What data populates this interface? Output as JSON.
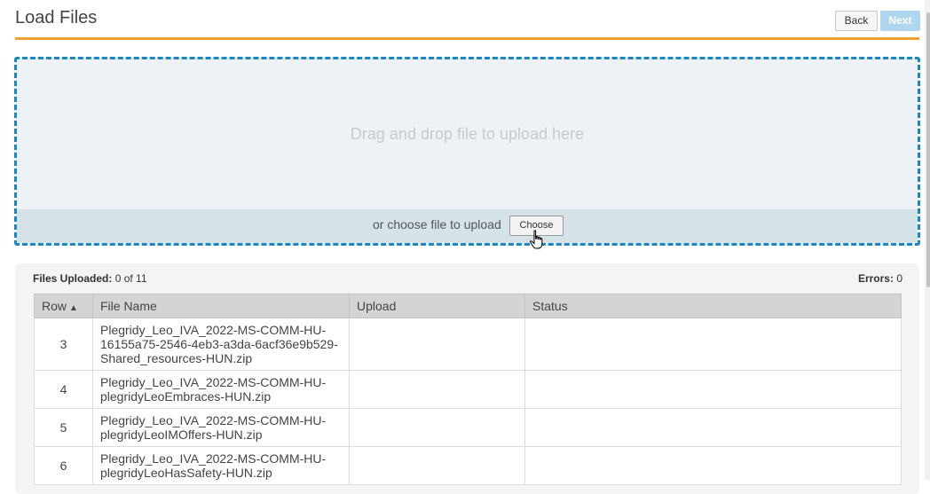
{
  "header": {
    "title": "Load Files",
    "back_label": "Back",
    "next_label": "Next"
  },
  "dropzone": {
    "drop_text": "Drag and drop file to upload here",
    "choose_text": "or choose file to upload",
    "choose_label": "Choose"
  },
  "summary": {
    "files_uploaded_label": "Files Uploaded:",
    "files_uploaded_value": "0 of 11",
    "errors_label": "Errors:",
    "errors_value": "0"
  },
  "table": {
    "columns": [
      "Row",
      "File Name",
      "Upload",
      "Status"
    ],
    "sort_indicator": "▲",
    "rows": [
      {
        "row": "3",
        "file_lines": [
          "Plegridy_Leo_IVA_2022-MS-COMM-HU-",
          "16155a75-2546-4eb3-a3da-6acf36e9b529-",
          "Shared_resources-HUN.zip"
        ],
        "upload": "",
        "status": ""
      },
      {
        "row": "4",
        "file_lines": [
          "Plegridy_Leo_IVA_2022-MS-COMM-HU-",
          "plegridyLeoEmbraces-HUN.zip"
        ],
        "upload": "",
        "status": ""
      },
      {
        "row": "5",
        "file_lines": [
          "Plegridy_Leo_IVA_2022-MS-COMM-HU-",
          "plegridyLeoIMOffers-HUN.zip"
        ],
        "upload": "",
        "status": ""
      },
      {
        "row": "6",
        "file_lines": [
          "Plegridy_Leo_IVA_2022-MS-COMM-HU-",
          "plegridyLeoHasSafety-HUN.zip"
        ],
        "upload": "",
        "status": ""
      }
    ]
  },
  "colors": {
    "accent_orange": "#f0a030",
    "dropzone_border": "#1a86c2",
    "next_button": "#aed6ee"
  },
  "icons": {
    "sort": "triangle-up-icon",
    "cursor": "hand-pointer-icon"
  }
}
